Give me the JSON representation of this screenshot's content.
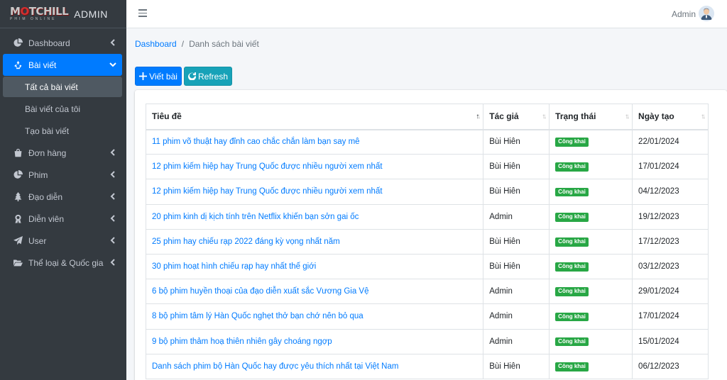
{
  "brand": {
    "logo_main_a": "M",
    "logo_main_red": "O",
    "logo_main_b": "TCHILL",
    "logo_sub": "PHIM ONLINE",
    "title": "ADMIN"
  },
  "sidebar": {
    "items": [
      {
        "label": "Dashboard",
        "icon": "chart-pie-icon"
      },
      {
        "label": "Bài viết",
        "icon": "recycle-icon",
        "active": true
      },
      {
        "label": "Đơn hàng",
        "icon": "shopping-bag-icon"
      },
      {
        "label": "Phim",
        "icon": "chart-pie-icon"
      },
      {
        "label": "Đạo diễn",
        "icon": "tree-icon"
      },
      {
        "label": "Diễn viên",
        "icon": "award-icon"
      },
      {
        "label": "User",
        "icon": "paper-plane-icon"
      },
      {
        "label": "Thể loại & Quốc gia",
        "icon": "folder-open-icon"
      }
    ],
    "subitems": [
      {
        "label": "Tất cả bài viết",
        "current": true
      },
      {
        "label": "Bài viết của tôi"
      },
      {
        "label": "Tạo bài viết"
      }
    ]
  },
  "topbar": {
    "admin_name": "Admin"
  },
  "breadcrumb": {
    "home": "Dashboard",
    "separator": "/",
    "current": "Danh sách bài viết"
  },
  "buttons": {
    "add_label": "Viết bài",
    "refresh_label": "Refresh"
  },
  "table": {
    "headers": [
      "Tiêu đề",
      "Tác giả",
      "Trạng thái",
      "Ngày tạo"
    ],
    "rows": [
      {
        "title": "11 phim võ thuật hay đỉnh cao chắc chắn làm bạn say mê",
        "author": "Bùi Hiên",
        "status": "Công khai",
        "date": "22/01/2024"
      },
      {
        "title": "12 phim kiếm hiệp hay Trung Quốc được nhiều người xem nhất",
        "author": "Bùi Hiên",
        "status": "Công khai",
        "date": "17/01/2024"
      },
      {
        "title": "12 phim kiếm hiệp hay Trung Quốc được nhiều người xem nhất",
        "author": "Bùi Hiên",
        "status": "Công khai",
        "date": "04/12/2023"
      },
      {
        "title": "20 phim kinh dị kịch tính trên Netflix khiến bạn sởn gai ốc",
        "author": "Admin",
        "status": "Công khai",
        "date": "19/12/2023"
      },
      {
        "title": "25 phim hay chiếu rạp 2022 đáng kỳ vọng nhất năm",
        "author": "Bùi Hiên",
        "status": "Công khai",
        "date": "17/12/2023"
      },
      {
        "title": "30 phim hoạt hình chiếu rạp hay nhất thế giới",
        "author": "Bùi Hiên",
        "status": "Công khai",
        "date": "03/12/2023"
      },
      {
        "title": "6 bộ phim huyền thoại của đạo diễn xuất sắc Vương Gia Vệ",
        "author": "Admin",
        "status": "Công khai",
        "date": "29/01/2024"
      },
      {
        "title": "8 bộ phim tâm lý Hàn Quốc nghẹt thở bạn chớ nên bỏ qua",
        "author": "Admin",
        "status": "Công khai",
        "date": "17/01/2024"
      },
      {
        "title": "9 bộ phim thảm hoạ thiên nhiên gây choáng ngợp",
        "author": "Admin",
        "status": "Công khai",
        "date": "15/01/2024"
      },
      {
        "title": "Danh sách phim bộ Hàn Quốc hay được yêu thích nhất tại Việt Nam",
        "author": "Bùi Hiên",
        "status": "Công khai",
        "date": "06/12/2023"
      }
    ]
  },
  "colors": {
    "primary": "#007bff",
    "info": "#17a2b8",
    "success": "#28a745",
    "sidebar_bg": "#343a40"
  }
}
